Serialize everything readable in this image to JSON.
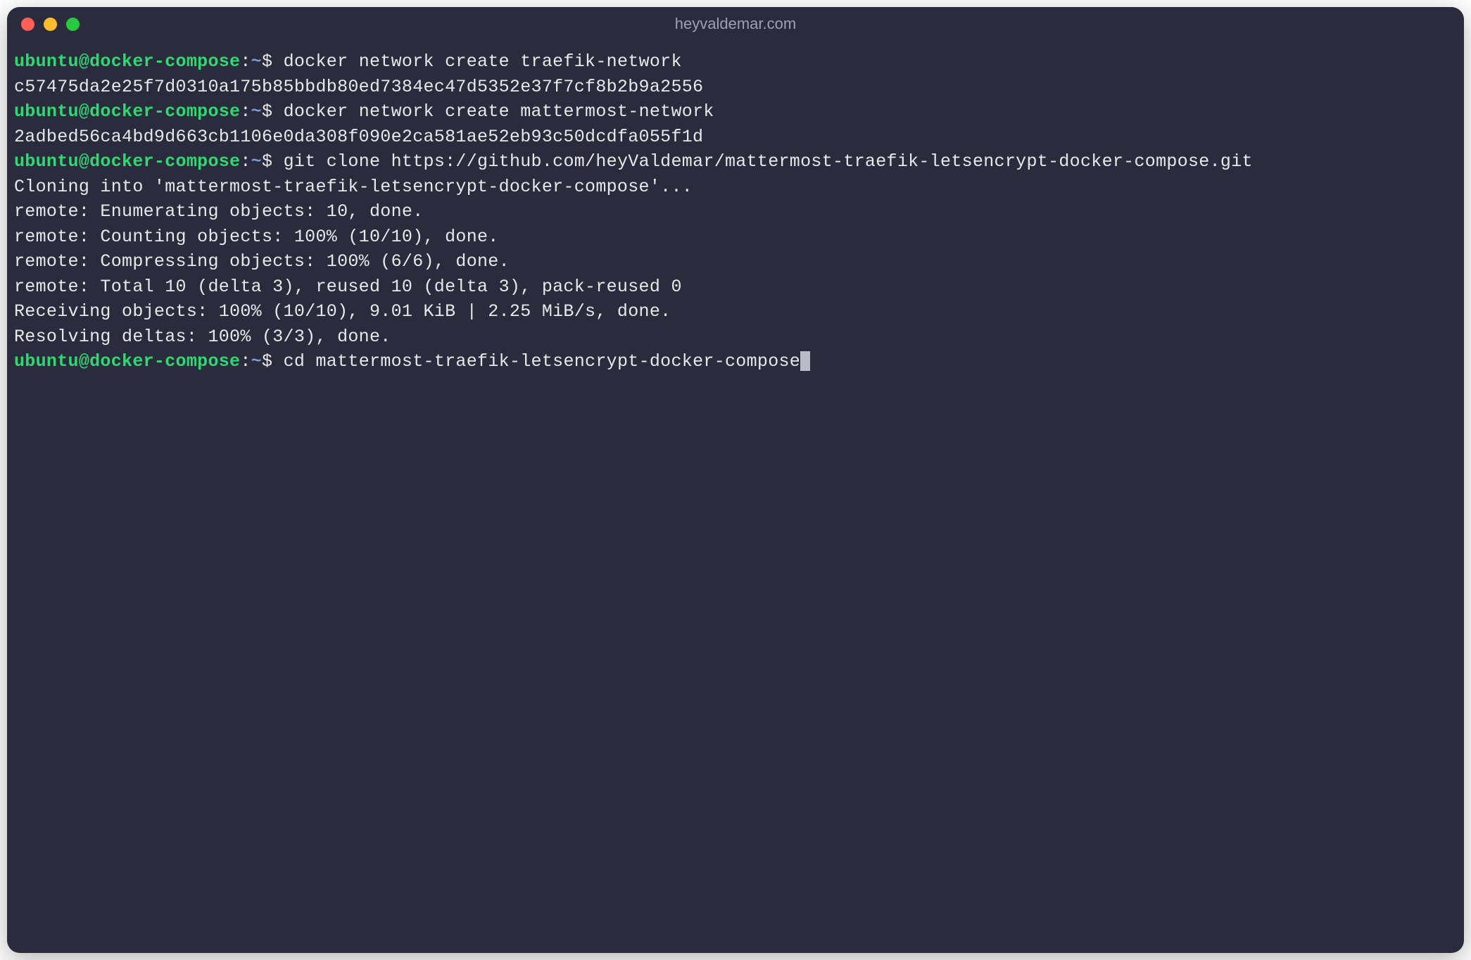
{
  "window": {
    "title": "heyvaldemar.com"
  },
  "prompt": {
    "user_host": "ubuntu@docker-compose",
    "sep": ":",
    "path": "~",
    "symbol": "$"
  },
  "lines": [
    {
      "type": "prompt",
      "command": "docker network create traefik-network"
    },
    {
      "type": "output",
      "text": "c57475da2e25f7d0310a175b85bbdb80ed7384ec47d5352e37f7cf8b2b9a2556"
    },
    {
      "type": "prompt",
      "command": "docker network create mattermost-network"
    },
    {
      "type": "output",
      "text": "2adbed56ca4bd9d663cb1106e0da308f090e2ca581ae52eb93c50dcdfa055f1d"
    },
    {
      "type": "prompt",
      "command": "git clone https://github.com/heyValdemar/mattermost-traefik-letsencrypt-docker-compose.git"
    },
    {
      "type": "output",
      "text": "Cloning into 'mattermost-traefik-letsencrypt-docker-compose'..."
    },
    {
      "type": "output",
      "text": "remote: Enumerating objects: 10, done."
    },
    {
      "type": "output",
      "text": "remote: Counting objects: 100% (10/10), done."
    },
    {
      "type": "output",
      "text": "remote: Compressing objects: 100% (6/6), done."
    },
    {
      "type": "output",
      "text": "remote: Total 10 (delta 3), reused 10 (delta 3), pack-reused 0"
    },
    {
      "type": "output",
      "text": "Receiving objects: 100% (10/10), 9.01 KiB | 2.25 MiB/s, done."
    },
    {
      "type": "output",
      "text": "Resolving deltas: 100% (3/3), done."
    },
    {
      "type": "prompt",
      "command": "cd mattermost-traefik-letsencrypt-docker-compose",
      "cursor": true
    }
  ]
}
